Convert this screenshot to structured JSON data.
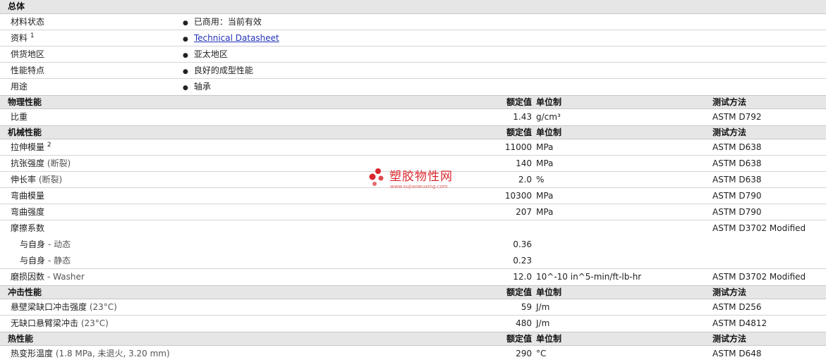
{
  "general": {
    "heading": "总体",
    "rows": [
      {
        "name": "材料状态",
        "value": "已商用：当前有效"
      },
      {
        "name": "资料",
        "sup": "1",
        "value": "Technical Datasheet",
        "link": true
      },
      {
        "name": "供货地区",
        "value": "亚太地区"
      },
      {
        "name": "性能特点",
        "value": "良好的成型性能"
      },
      {
        "name": "用途",
        "value": "轴承"
      }
    ]
  },
  "columns": {
    "value": "额定值",
    "unit": "单位制",
    "method": "测试方法"
  },
  "physical": {
    "heading": "物理性能",
    "rows": [
      {
        "name": "比重",
        "value": "1.43",
        "unit": "g/cm³",
        "method": "ASTM D792"
      }
    ]
  },
  "mechanical": {
    "heading": "机械性能",
    "rows": [
      {
        "name": "拉伸模量",
        "sup": "2",
        "value": "11000",
        "unit": "MPa",
        "method": "ASTM D638"
      },
      {
        "name": "抗张强度",
        "paren": "(断裂)",
        "value": "140",
        "unit": "MPa",
        "method": "ASTM D638"
      },
      {
        "name": "伸长率",
        "paren": "(断裂)",
        "value": "2.0",
        "unit": "%",
        "method": "ASTM D638"
      },
      {
        "name": "弯曲模量",
        "value": "10300",
        "unit": "MPa",
        "method": "ASTM D790"
      },
      {
        "name": "弯曲强度",
        "value": "207",
        "unit": "MPa",
        "method": "ASTM D790"
      }
    ],
    "friction": {
      "name": "摩擦系数",
      "method": "ASTM D3702 Modified",
      "subrows": [
        {
          "name": "与自身",
          "suffix": "- 动态",
          "value": "0.36"
        },
        {
          "name": "与自身",
          "suffix": "- 静态",
          "value": "0.23"
        }
      ]
    },
    "wear": {
      "name": "磨损因数",
      "suffix": "- Washer",
      "value": "12.0",
      "unit": "10^-10 in^5-min/ft-lb-hr",
      "method": "ASTM D3702 Modified"
    }
  },
  "impact": {
    "heading": "冲击性能",
    "rows": [
      {
        "name": "悬壁梁缺口冲击强度",
        "paren": "(23°C)",
        "value": "59",
        "unit": "J/m",
        "method": "ASTM D256"
      },
      {
        "name": "无缺口悬臂梁冲击",
        "paren": "(23°C)",
        "value": "480",
        "unit": "J/m",
        "method": "ASTM D4812"
      }
    ]
  },
  "thermal": {
    "heading": "热性能",
    "rows": [
      {
        "name": "热变形温度",
        "paren": "(1.8 MPa, 未退火, 3.20 mm)",
        "value": "290",
        "unit": "°C",
        "method": "ASTM D648"
      }
    ]
  },
  "watermark": {
    "title": "塑胶物性网",
    "url": "www.sujiaowuxing.com",
    "color": "#d8282e"
  },
  "icons": {
    "bullet": "bullet-dot"
  }
}
